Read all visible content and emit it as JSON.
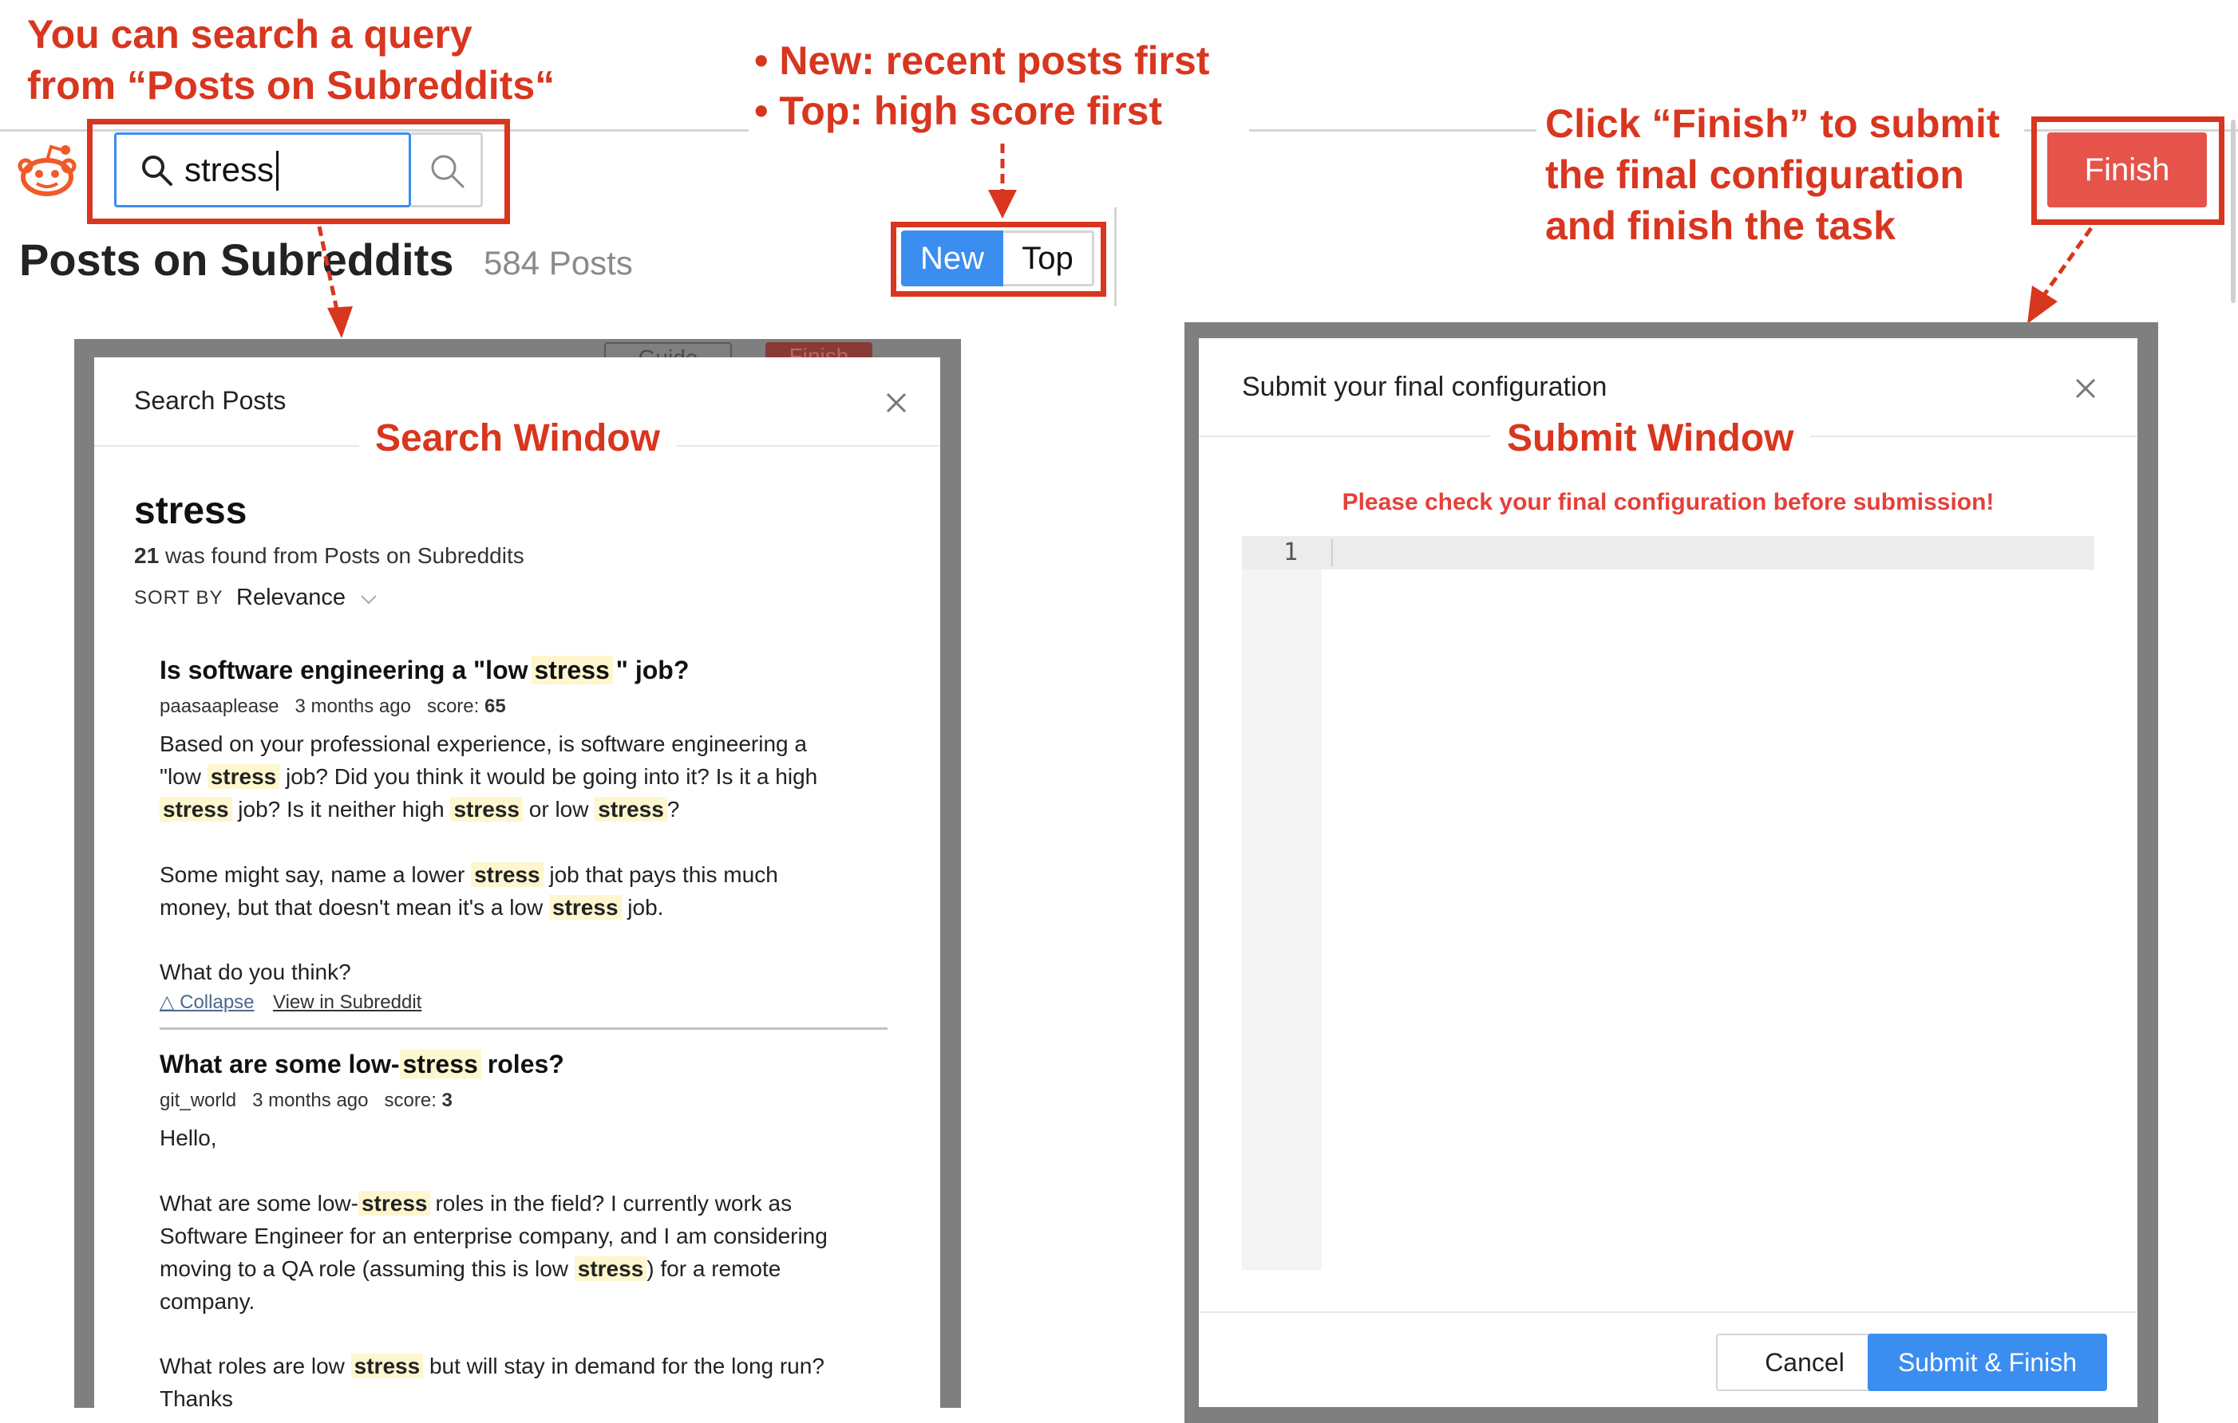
{
  "annotations": {
    "search_hint_line1": "You can search a query",
    "search_hint_line2": "from “Posts on Subreddits“",
    "sort_hint_new": "New: recent posts first",
    "sort_hint_top": "Top: high score first",
    "finish_hint_line1": "Click “Finish” to submit",
    "finish_hint_line2": "the final configuration",
    "finish_hint_line3": "and finish the task",
    "search_window_label": "Search Window",
    "submit_window_label": "Submit Window"
  },
  "app": {
    "logo_icon": "reddit-logo-icon",
    "search_value": "stress",
    "page_title": "Posts on Subreddits",
    "post_count": "584 Posts",
    "sort_new": "New",
    "sort_top": "Top",
    "finish_label": "Finish"
  },
  "search_window": {
    "title": "Search Posts",
    "query": "stress",
    "found_count": "21",
    "found_text": "was found from Posts on Subreddits",
    "sort_by_label": "SORT BY",
    "sort_by_value": "Relevance",
    "results": [
      {
        "title_pre": "Is software engineering a \"low",
        "title_hl": "stress",
        "title_post": "\" job?",
        "author": "paasaaplease",
        "time": "3 months ago",
        "score_label": "score:",
        "score": "65",
        "line1": "Based on your professional experience, is software engineering a",
        "line2_a": "\"low",
        "hl": "stress",
        "line2_b": "job? Did you think it would be going into it? Is it a high",
        "line3_b": "job? Is it neither high",
        "line3_c": "or low",
        "line3_d": "?",
        "line4_a": "Some might say, name a lower",
        "line4_b": "job that pays this much",
        "line5_a": "money, but that doesn't mean it's a low",
        "line5_b": "job.",
        "line6": "What do you think?",
        "collapse": "△ Collapse",
        "view": "View in Subreddit"
      },
      {
        "title_pre": "What are some low-",
        "title_hl": "stress",
        "title_post": "roles?",
        "author": "git_world",
        "time": "3 months ago",
        "score_label": "score:",
        "score": "3",
        "line1": "Hello,",
        "line2_a": "What are some low-",
        "hl": "stress",
        "line2_b": "roles in the field? I currently work as",
        "line3": "Software Engineer for an enterprise company, and I am considering",
        "line4_a": "moving to a QA role (assuming this is low",
        "line4_b": ") for a remote",
        "line5": "company.",
        "line6_a": "What roles are low",
        "line6_b": "but will stay in demand for the long run?",
        "line7": "Thanks"
      }
    ]
  },
  "submit_window": {
    "title": "Submit your final configuration",
    "warning": "Please check your final configuration before submission!",
    "line_number": "1",
    "cancel_label": "Cancel",
    "submit_label": "Submit & Finish"
  },
  "background_fragments": {
    "guide": "Guide",
    "finish": "Finish"
  }
}
